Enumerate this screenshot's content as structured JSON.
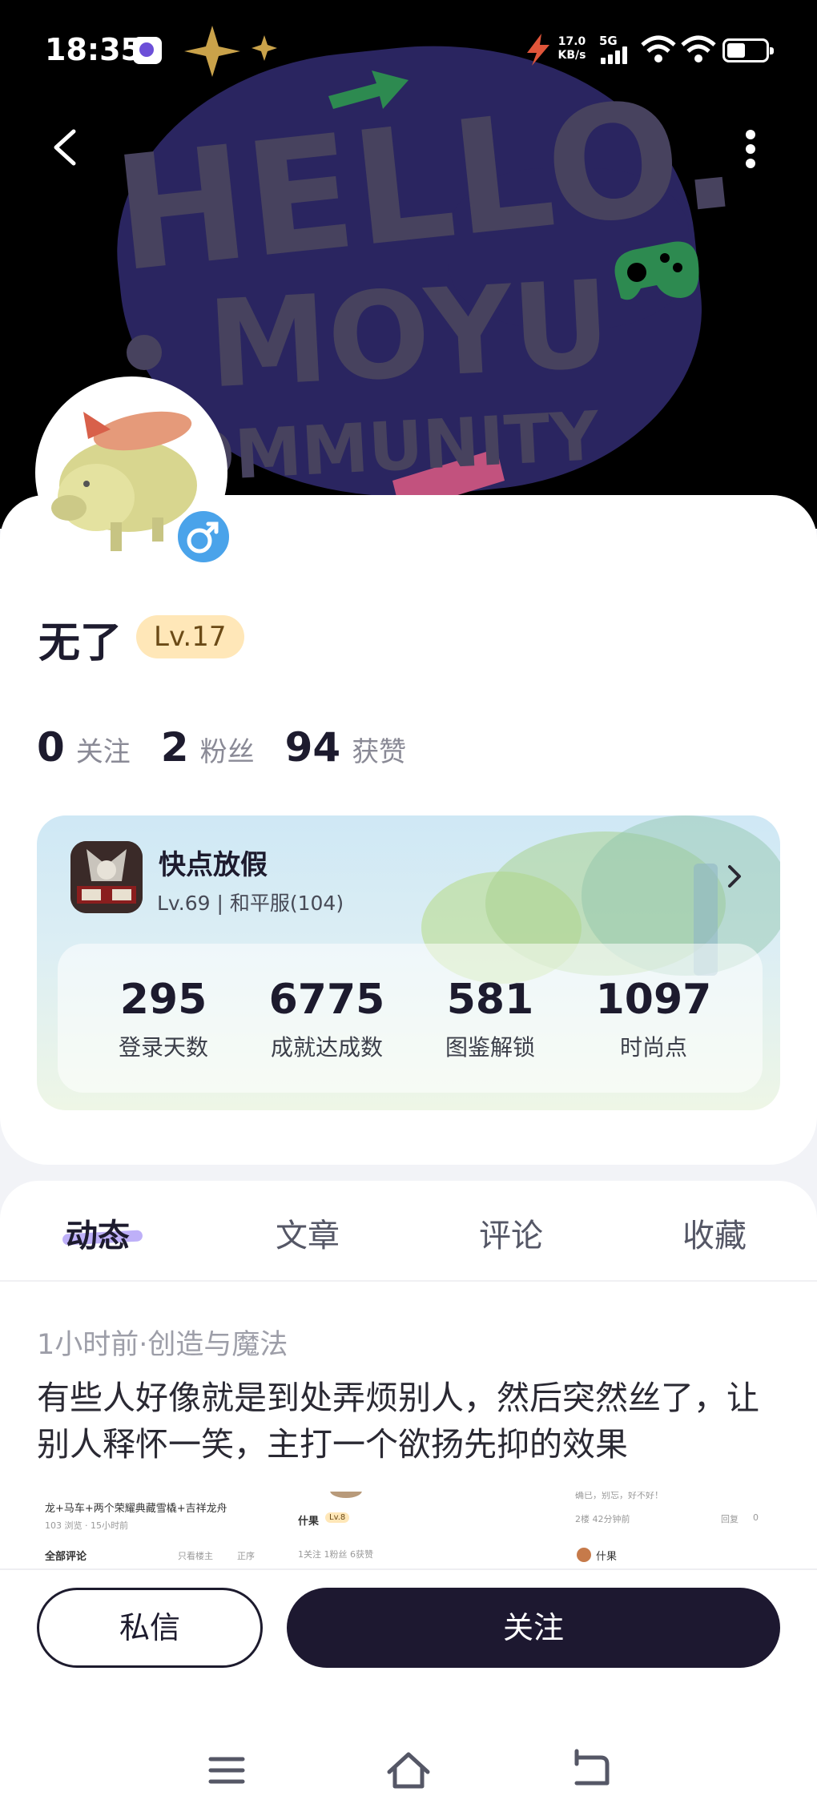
{
  "status_bar": {
    "time": "18:35",
    "net_speed_value": "17.0",
    "net_speed_unit": "KB/s",
    "signal_label": "5G",
    "icons": [
      "app-notification-icon",
      "data-speed-icon",
      "signal-icon",
      "wifi-icon",
      "wifi-icon",
      "battery-icon"
    ]
  },
  "banner": {
    "line1": "HELLO.",
    "line2": "MOYU",
    "line3": "COMMUNITY"
  },
  "profile": {
    "username": "无了",
    "level": "Lv.17",
    "gender_icon": "male-icon",
    "stats": [
      {
        "value": "0",
        "label": "关注"
      },
      {
        "value": "2",
        "label": "粉丝"
      },
      {
        "value": "94",
        "label": "获赞"
      }
    ]
  },
  "game_card": {
    "name": "快点放假",
    "subtitle": "Lv.69 | 和平服(104)",
    "icon": "game-logo-icon",
    "stats": [
      {
        "value": "295",
        "label": "登录天数"
      },
      {
        "value": "6775",
        "label": "成就达成数"
      },
      {
        "value": "581",
        "label": "图鉴解锁"
      },
      {
        "value": "1097",
        "label": "时尚点"
      }
    ]
  },
  "tabs": [
    "动态",
    "文章",
    "评论",
    "收藏"
  ],
  "post": {
    "meta": "1小时前·创造与魔法",
    "text": "有些人好像就是到处弄烦别人，然后突然丝了，让别人释怀一笑，主打一个欲扬先抑的效果",
    "thumb1_title": "龙+马车+两个荣耀典藏雪橇+吉祥龙舟",
    "thumb1_sub": "103 浏览 · 15小时前",
    "thumb1_comments": "全部评论",
    "thumb1_filter": "只看楼主",
    "thumb1_sort": "正序",
    "thumb2_name": "什果",
    "thumb2_level": "Lv.8",
    "thumb2_stats": "1关注  1粉丝  6获赞",
    "thumb3_text": "确已，别忘，好不好！",
    "thumb3_floor": "2楼 42分钟前",
    "thumb3_reply": "回复",
    "thumb3_likes": "0",
    "thumb3_name": "什果"
  },
  "actions": {
    "message": "私信",
    "follow": "关注"
  },
  "colors": {
    "banner_bg": "#000000",
    "banner_shape": "#2a2560",
    "follow_button": "#1d1830",
    "level_badge": "#ffe7b8",
    "gender_badge": "#4aa3ea",
    "tab_underline": "#b3a2f7"
  }
}
